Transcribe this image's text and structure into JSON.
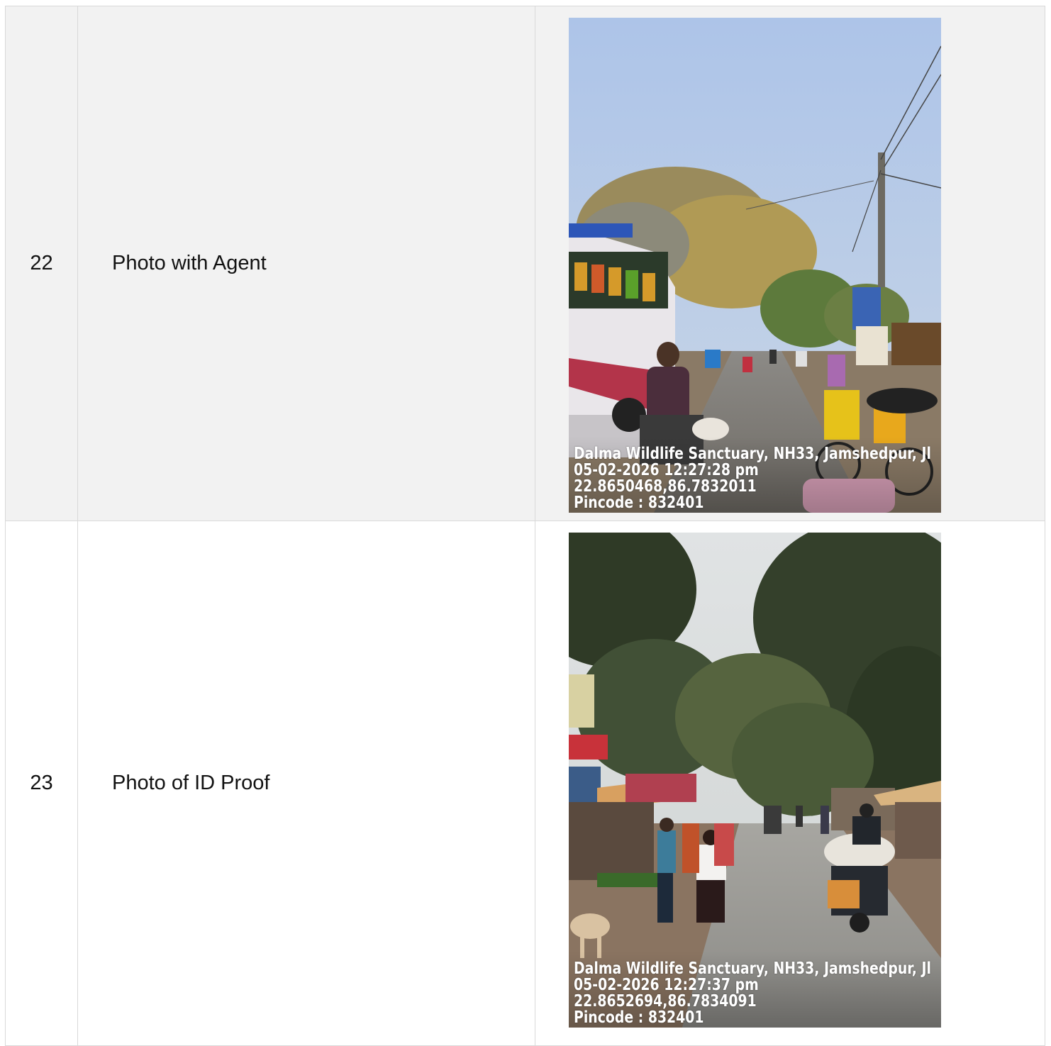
{
  "rows": [
    {
      "number": "22",
      "label": "Photo with Agent",
      "photo": {
        "stamp_line1": "Dalma Wildlife Sanctuary, NH33, Jamshedpur, Jl",
        "stamp_line2": "05-02-2026 12:27:28 pm",
        "stamp_line3": "22.8650468,86.7832011",
        "stamp_line4": "Pincode : 832401"
      }
    },
    {
      "number": "23",
      "label": "Photo of ID Proof",
      "photo": {
        "stamp_line1": "Dalma Wildlife Sanctuary, NH33, Jamshedpur, Jl",
        "stamp_line2": "05-02-2026 12:27:37 pm",
        "stamp_line3": "22.8652694,86.7834091",
        "stamp_line4": "Pincode : 832401"
      }
    }
  ],
  "colors": {
    "row_alt_bg": "#f2f2f2",
    "border": "#d9d9d9",
    "sky_1": "#b3c8e8",
    "sky_2": "#dbe0e2"
  }
}
